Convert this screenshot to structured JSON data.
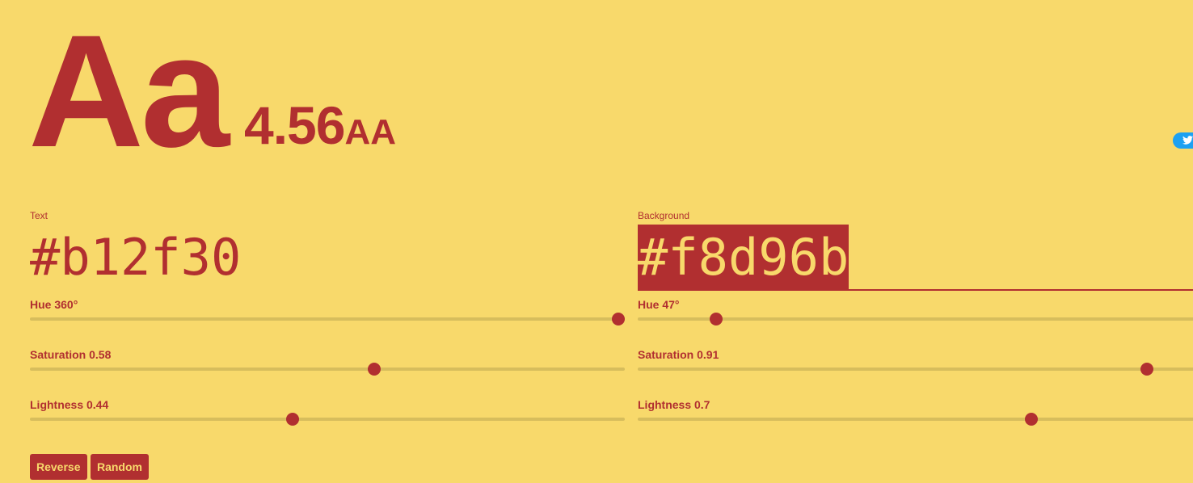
{
  "sample": {
    "text": "Aa"
  },
  "contrast": {
    "ratio": "4.56",
    "rating": "AA"
  },
  "colors": {
    "text": "#b12f30",
    "background": "#f8d96b",
    "track": "#d7bd5c",
    "twitter": "#1da1f2"
  },
  "tweet": {
    "icon": "twitter-bird-icon"
  },
  "text_panel": {
    "label": "Text",
    "hex": "#b12f30",
    "hue": {
      "label": "Hue 360°",
      "value": 360,
      "max": 360
    },
    "saturation": {
      "label": "Saturation 0.58",
      "value": 0.58,
      "max": 1
    },
    "lightness": {
      "label": "Lightness 0.44",
      "value": 0.44,
      "max": 1
    }
  },
  "background_panel": {
    "label": "Background",
    "hex": "#f8d96b",
    "hue": {
      "label": "Hue 47°",
      "value": 47,
      "max": 360
    },
    "saturation": {
      "label": "Saturation 0.91",
      "value": 0.91,
      "max": 1
    },
    "lightness": {
      "label": "Lightness 0.7",
      "value": 0.7,
      "max": 1
    }
  },
  "buttons": {
    "reverse": "Reverse",
    "random": "Random"
  }
}
